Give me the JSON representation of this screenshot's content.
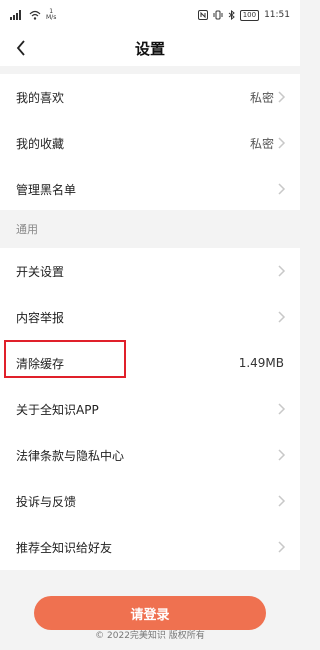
{
  "status_bar": {
    "speed": "1",
    "speed_unit": "M/s",
    "battery": "100",
    "time": "11:51",
    "icons": [
      "signal-icon",
      "wifi-icon",
      "nfc-icon",
      "vibrate-icon",
      "bluetooth-icon",
      "battery-icon"
    ]
  },
  "header": {
    "title": "设置",
    "back_icon": "chevron-left-icon"
  },
  "items": [
    {
      "label": "我的喜欢",
      "value": "私密"
    },
    {
      "label": "我的收藏",
      "value": "私密"
    },
    {
      "label": "管理黑名单",
      "value": ""
    }
  ],
  "section_general": "通用",
  "general_items": [
    {
      "label": "开关设置",
      "value": ""
    },
    {
      "label": "内容举报",
      "value": ""
    },
    {
      "label": "清除缓存",
      "value": "1.49MB"
    },
    {
      "label": "关于全知识APP",
      "value": ""
    },
    {
      "label": "法律条款与隐私中心",
      "value": ""
    },
    {
      "label": "投诉与反馈",
      "value": ""
    },
    {
      "label": "推荐全知识给好友",
      "value": ""
    }
  ],
  "login_button": "请登录",
  "copyright": "© 2022完美知识 版权所有",
  "colors": {
    "accent": "#ef7150",
    "highlight_border": "#e0202a",
    "background": "#f3f3f3"
  }
}
